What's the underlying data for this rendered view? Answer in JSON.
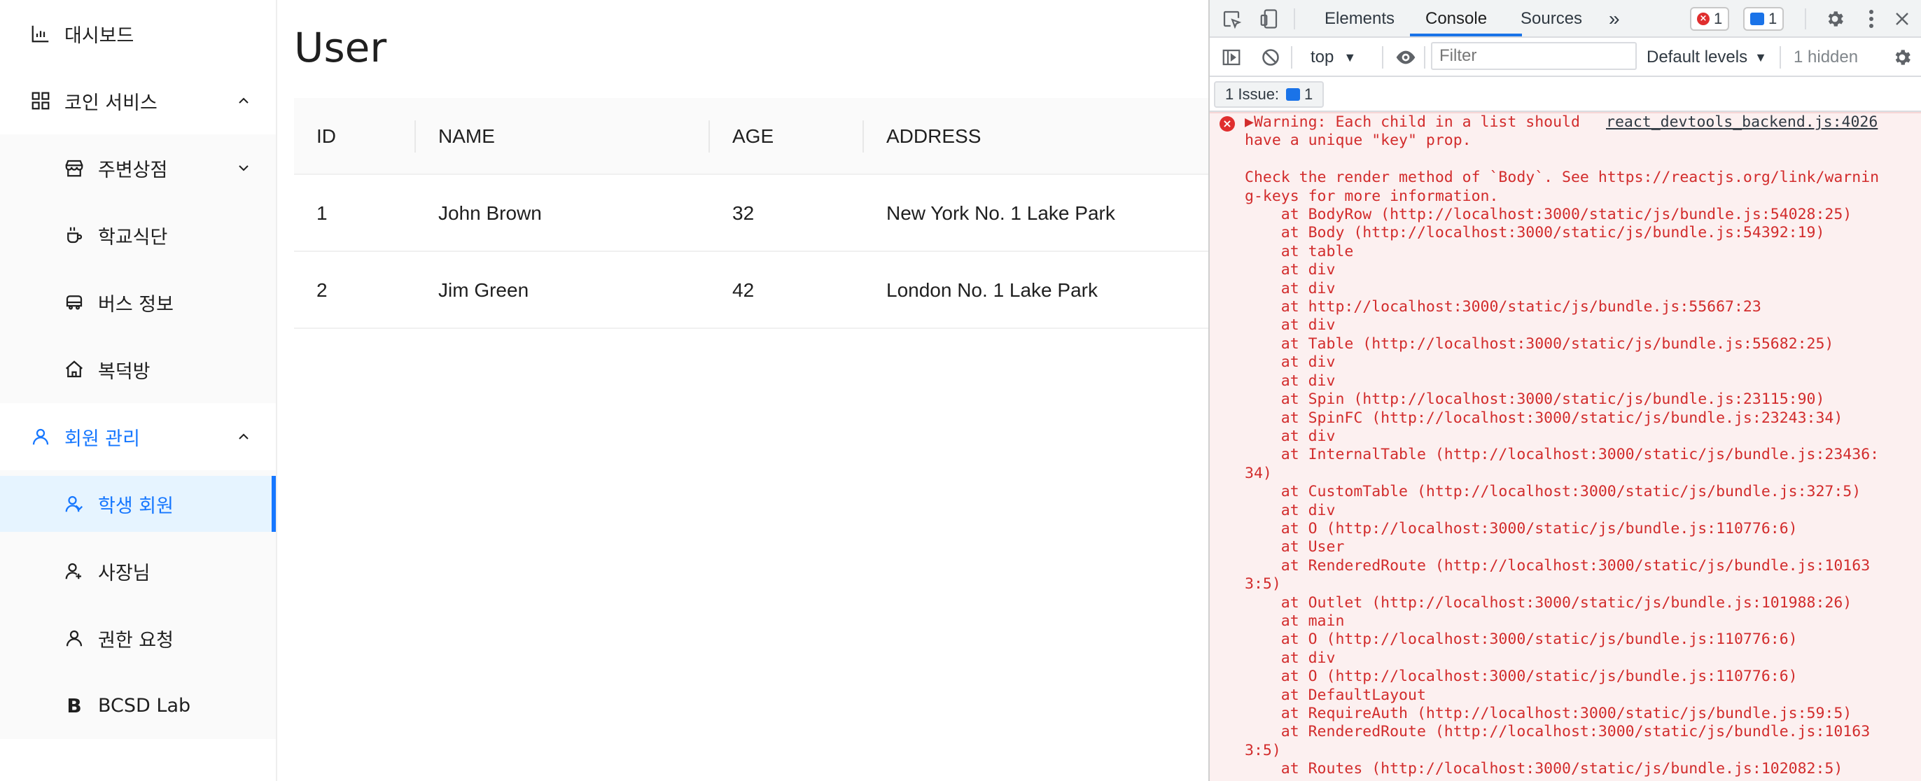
{
  "sidebar": {
    "items": [
      {
        "label": "대시보드",
        "icon": "bar-chart-icon"
      },
      {
        "label": "코인 서비스",
        "icon": "grid-icon",
        "expanded": true
      },
      {
        "label": "주변상점",
        "icon": "shop-icon"
      },
      {
        "label": "학교식단",
        "icon": "coffee-icon"
      },
      {
        "label": "버스 정보",
        "icon": "bus-icon"
      },
      {
        "label": "복덕방",
        "icon": "home-icon"
      },
      {
        "label": "회원 관리",
        "icon": "user-icon",
        "expanded": true
      },
      {
        "label": "학생 회원",
        "icon": "student-icon",
        "selected": true
      },
      {
        "label": "사장님",
        "icon": "owner-icon"
      },
      {
        "label": "권한 요청",
        "icon": "user-icon"
      },
      {
        "label": "BCSD Lab",
        "icon": "b-letter-icon"
      }
    ]
  },
  "main": {
    "title": "User",
    "table": {
      "columns": [
        "ID",
        "NAME",
        "AGE",
        "ADDRESS"
      ],
      "rows": [
        [
          "1",
          "John Brown",
          "32",
          "New York No. 1 Lake Park"
        ],
        [
          "2",
          "Jim Green",
          "42",
          "London No. 1 Lake Park"
        ]
      ]
    }
  },
  "devtools": {
    "tabs": [
      "Elements",
      "Console",
      "Sources"
    ],
    "active_tab": "Console",
    "more_tabs": "»",
    "error_count": "1",
    "message_count": "1",
    "context": "top",
    "filter_placeholder": "Filter",
    "levels": "Default levels",
    "hidden": "1 hidden",
    "issues_label": "1 Issue:",
    "issues_count": "1",
    "source_link": "react_devtools_backend.js:4026",
    "message_text": "▶Warning: Each child in a list should\nhave a unique \"key\" prop.\n\nCheck the render method of `Body`. See https://reactjs.org/link/warnin\ng-keys for more information.\n    at BodyRow (http://localhost:3000/static/js/bundle.js:54028:25)\n    at Body (http://localhost:3000/static/js/bundle.js:54392:19)\n    at table\n    at div\n    at div\n    at http://localhost:3000/static/js/bundle.js:55667:23\n    at div\n    at Table (http://localhost:3000/static/js/bundle.js:55682:25)\n    at div\n    at div\n    at Spin (http://localhost:3000/static/js/bundle.js:23115:90)\n    at SpinFC (http://localhost:3000/static/js/bundle.js:23243:34)\n    at div\n    at InternalTable (http://localhost:3000/static/js/bundle.js:23436:\n34)\n    at CustomTable (http://localhost:3000/static/js/bundle.js:327:5)\n    at div\n    at O (http://localhost:3000/static/js/bundle.js:110776:6)\n    at User\n    at RenderedRoute (http://localhost:3000/static/js/bundle.js:10163\n3:5)\n    at Outlet (http://localhost:3000/static/js/bundle.js:101988:26)\n    at main\n    at O (http://localhost:3000/static/js/bundle.js:110776:6)\n    at div\n    at O (http://localhost:3000/static/js/bundle.js:110776:6)\n    at DefaultLayout\n    at RequireAuth (http://localhost:3000/static/js/bundle.js:59:5)\n    at RenderedRoute (http://localhost:3000/static/js/bundle.js:10163\n3:5)\n    at Routes (http://localhost:3000/static/js/bundle.js:102082:5)"
  },
  "colors": {
    "accent": "#1677ff",
    "error": "#d22c2c",
    "devtools_active": "#1a73e8"
  }
}
